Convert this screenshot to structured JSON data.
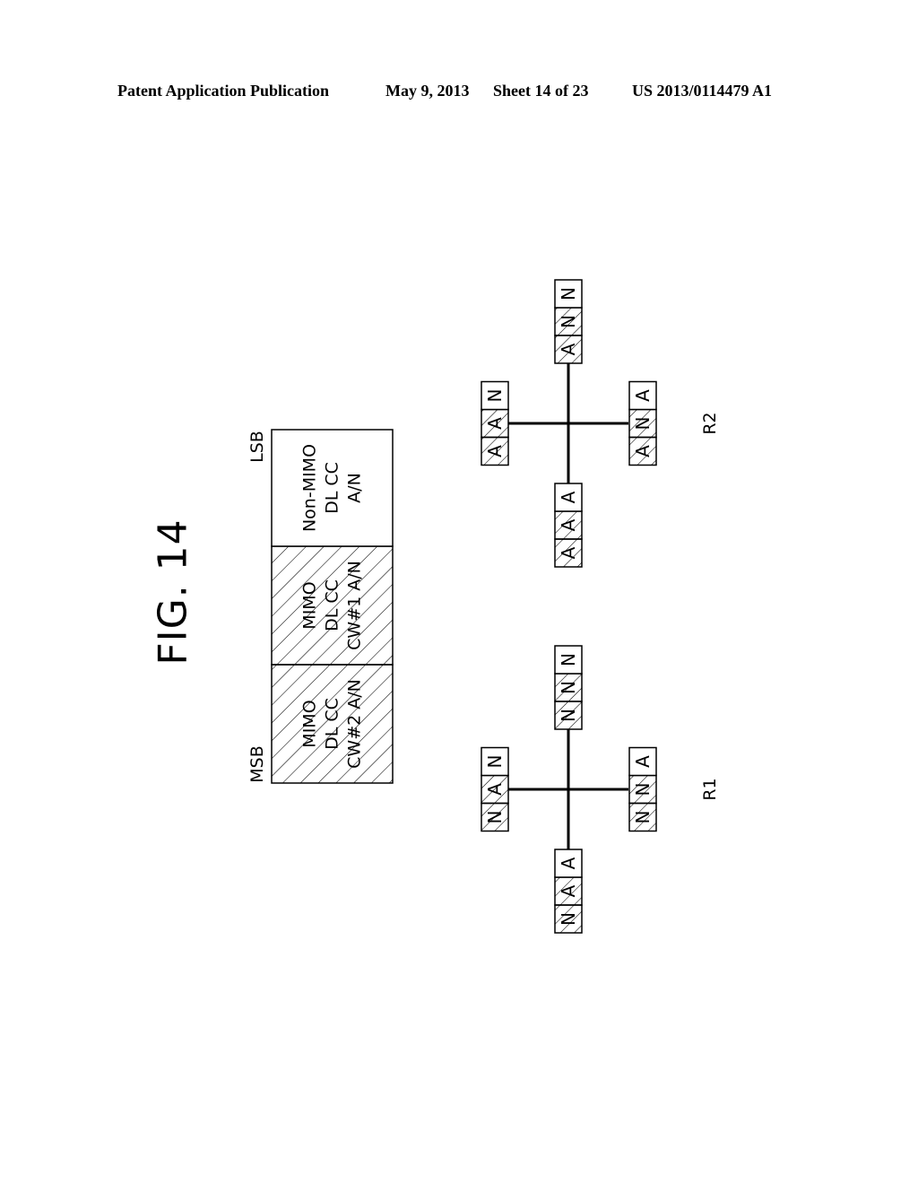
{
  "header": {
    "publication": "Patent Application Publication",
    "date": "May 9, 2013",
    "sheet": "Sheet 14 of 23",
    "number": "US 2013/0114479 A1"
  },
  "figure": {
    "title": "FIG. 14",
    "bit_field": {
      "msb_label": "MSB",
      "lsb_label": "LSB",
      "cells": [
        {
          "lines": [
            "MIMO",
            "DL CC",
            "CW#2 A/N"
          ],
          "hatched": true
        },
        {
          "lines": [
            "MIMO",
            "DL CC",
            "CW#1 A/N"
          ],
          "hatched": true
        },
        {
          "lines": [
            "Non-MIMO",
            "DL CC",
            "A/N"
          ],
          "hatched": false
        }
      ]
    },
    "constellations": [
      {
        "label": "R1",
        "points": {
          "top": [
            "N",
            "N",
            "N"
          ],
          "left": [
            "N",
            "A",
            "N"
          ],
          "right": [
            "N",
            "N",
            "A"
          ],
          "bottom": [
            "N",
            "A",
            "A"
          ]
        }
      },
      {
        "label": "R2",
        "points": {
          "top": [
            "A",
            "N",
            "N"
          ],
          "left": [
            "A",
            "A",
            "N"
          ],
          "right": [
            "A",
            "N",
            "A"
          ],
          "bottom": [
            "A",
            "A",
            "A"
          ]
        }
      }
    ]
  }
}
